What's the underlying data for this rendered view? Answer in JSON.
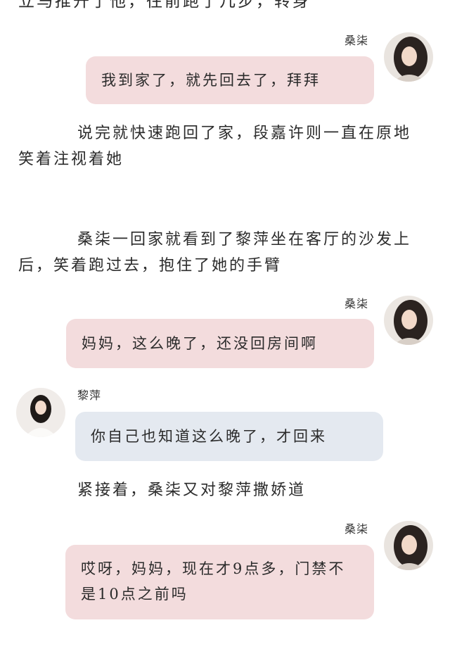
{
  "top_partial_text": "立马推开了他，往前跑了几步，转身",
  "messages": [
    {
      "speaker": "桑柒",
      "text": "我到家了，就先回去了，拜拜"
    }
  ],
  "narration_1": "说完就快速跑回了家，段嘉许则一直在原地笑着注视着她",
  "narration_2": "桑柒一回家就看到了黎萍坐在客厅的沙发上后，笑着跑过去，抱住了她的手臂",
  "chat": {
    "m2": {
      "speaker": "桑柒",
      "text": "妈妈，这么晚了，还没回房间啊"
    },
    "m3": {
      "speaker": "黎萍",
      "text": "你自己也知道这么晚了，才回来"
    },
    "m4": {
      "speaker": "桑柒",
      "text": "哎呀，妈妈，现在才9点多，门禁不是10点之前吗"
    }
  },
  "narration_3": "紧接着，桑柒又对黎萍撒娇道",
  "colors": {
    "bubble_pink": "#f3dcdd",
    "bubble_blue": "#e4e9f0",
    "text": "#2b2b2b"
  }
}
